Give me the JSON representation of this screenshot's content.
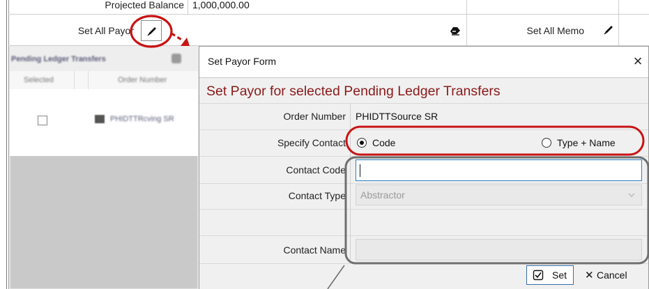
{
  "background": {
    "projected_balance_label": "Projected Balance",
    "projected_balance_value": "1,000,000.00",
    "set_all_payor_label": "Set All Payor",
    "set_all_memo_label": "Set All Memo",
    "ledger_title": "Pending Ledger Transfers",
    "ledger_columns": [
      "Selected",
      "Order Number"
    ],
    "ledger_row_order": "PHIDTTRcving SR"
  },
  "dialog": {
    "title": "Set Payor Form",
    "close_glyph": "×",
    "header": "Set Payor for selected Pending Ledger Transfers",
    "order_number_label": "Order Number",
    "order_number_value": "PHIDTTSource SR",
    "specify_contact_label": "Specify Contact",
    "radio_code_label": "Code",
    "radio_type_name_label": "Type + Name",
    "selected_radio": "Code",
    "contact_code_label": "Contact Code",
    "contact_code_value": "",
    "contact_type_label": "Contact Type",
    "contact_type_value": "Abstractor",
    "contact_name_label": "Contact Name",
    "contact_name_value": "",
    "set_label": "Set",
    "cancel_label": "Cancel",
    "cancel_glyph": "✕"
  },
  "colors": {
    "header_text": "#8b1a1a",
    "annotation_red": "#c81414",
    "annotation_gray": "#6f6f6f"
  }
}
